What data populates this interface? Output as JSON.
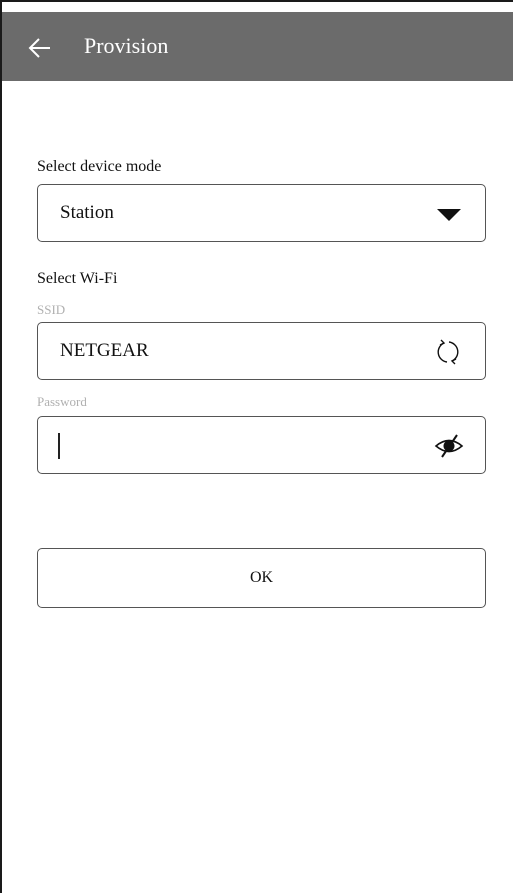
{
  "appbar": {
    "title": "Provision",
    "back_icon": "arrow-left-icon",
    "color": "#6b6b6b"
  },
  "device_mode": {
    "label": "Select device mode",
    "value": "Station",
    "icon": "dropdown-triangle-icon"
  },
  "wifi": {
    "section_label": "Select Wi-Fi",
    "ssid": {
      "hint": "SSID",
      "value": "NETGEAR",
      "icon": "refresh-icon"
    },
    "password": {
      "hint": "Password",
      "value": "",
      "icon": "eye-off-icon"
    }
  },
  "ok_button": {
    "label": "OK"
  }
}
